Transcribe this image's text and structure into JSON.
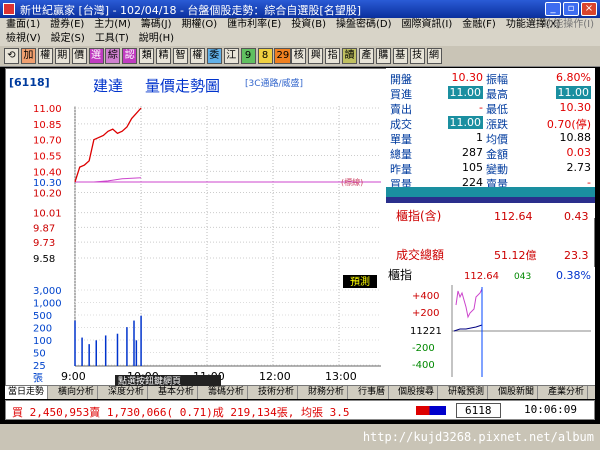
{
  "window": {
    "title": "新世紀贏家 [台灣] - 102/04/18 - 台盤個股走勢：綜合自選股[名望股]",
    "min": "_",
    "max": "▫",
    "close": "×"
  },
  "menu1": [
    "畫面(1)",
    "證券(E)",
    "主力(M)",
    "籌碼(J)",
    "期權(O)",
    "匯市利率(E)",
    "投資(B)",
    "操盤密碼(D)",
    "國際資訊(I)",
    "金融(F)",
    "功能選擇(X)"
  ],
  "menu1_right": "功能操作(I)",
  "menu2": [
    "檢視(V)",
    "設定(S)",
    "工具(T)",
    "說明(H)"
  ],
  "toolbar": [
    {
      "t": "⟲",
      "c": "#e8e4d8",
      "f": "#000"
    },
    {
      "t": "加",
      "c": "#f0a070",
      "f": "#000"
    },
    {
      "t": "權",
      "c": "#e8e4d8",
      "f": "#000"
    },
    {
      "t": "期",
      "c": "#e8e4d8",
      "f": "#000"
    },
    {
      "t": "價",
      "c": "#e8e4d8",
      "f": "#000"
    },
    {
      "t": "選",
      "c": "#c03cc0",
      "f": "#fff"
    },
    {
      "t": "綜",
      "c": "#d080d0",
      "f": "#000"
    },
    {
      "t": "認",
      "c": "#c03cc0",
      "f": "#fff"
    },
    {
      "t": "類",
      "c": "#e8e4d8",
      "f": "#000"
    },
    {
      "t": "精",
      "c": "#e8e4d8",
      "f": "#000"
    },
    {
      "t": "智",
      "c": "#e8e4d8",
      "f": "#000"
    },
    {
      "t": "權",
      "c": "#e8e4d8",
      "f": "#000"
    },
    {
      "t": "委",
      "c": "#60b0e8",
      "f": "#000"
    },
    {
      "t": "江",
      "c": "#e8e4d8",
      "f": "#000"
    },
    {
      "t": "9",
      "c": "#60c060",
      "f": "#000"
    },
    {
      "t": "8",
      "c": "#f0d040",
      "f": "#000"
    },
    {
      "t": "29",
      "c": "#f08020",
      "f": "#000"
    },
    {
      "t": "核",
      "c": "#e8e4d8",
      "f": "#000"
    },
    {
      "t": "興",
      "c": "#e8e4d8",
      "f": "#000"
    },
    {
      "t": "指",
      "c": "#e8e4d8",
      "f": "#000"
    },
    {
      "t": "讀",
      "c": "#c0c060",
      "f": "#000"
    },
    {
      "t": "產",
      "c": "#e8e4d8",
      "f": "#000"
    },
    {
      "t": "購",
      "c": "#e8e4d8",
      "f": "#000"
    },
    {
      "t": "基",
      "c": "#e8e4d8",
      "f": "#000"
    },
    {
      "t": "技",
      "c": "#e8e4d8",
      "f": "#000"
    },
    {
      "t": "網",
      "c": "#e8e4d8",
      "f": "#000"
    }
  ],
  "stock": {
    "code": "[6118]",
    "name": "建達",
    "chart_title": "量價走勢圖",
    "sub": "[3C通路/威盛]"
  },
  "price_axis": [
    "11.00",
    "10.85",
    "10.70",
    "10.55",
    "10.40",
    "10.30",
    "10.20",
    "10.01",
    "9.87",
    "9.73",
    "9.58"
  ],
  "price_axis_ref": "10.30",
  "ref_tag": "(標線)",
  "vol_axis": [
    "3,000",
    "1,000",
    "500",
    "200",
    "100",
    "50",
    "25",
    "張"
  ],
  "time_axis": [
    "9:00",
    "10:00",
    "11:00",
    "12:00",
    "13:00"
  ],
  "predict_button": "預測",
  "info": {
    "open": {
      "label": "開盤",
      "value": "10.30"
    },
    "amp": {
      "label": "振幅",
      "value": "6.80%"
    },
    "bid": {
      "label": "買進",
      "value": "11.00"
    },
    "high": {
      "label": "最高",
      "value": "11.00"
    },
    "ask": {
      "label": "賣出",
      "value": "-"
    },
    "low": {
      "label": "最低",
      "value": "10.30"
    },
    "last": {
      "label": "成交",
      "value": "11.00"
    },
    "chg": {
      "label": "漲跌",
      "value": "0.70(停)"
    },
    "unit": {
      "label": "單量",
      "value": "1"
    },
    "avg": {
      "label": "均價",
      "value": "10.88"
    },
    "vol": {
      "label": "總量",
      "value": "287"
    },
    "amt": {
      "label": "金額",
      "value": "0.03"
    },
    "yvol": {
      "label": "昨量",
      "value": "105"
    },
    "turn": {
      "label": "變動",
      "value": "2.73"
    },
    "buy": {
      "label": "買量",
      "value": "224"
    },
    "sell": {
      "label": "賣量",
      "value": "-"
    }
  },
  "index_box": {
    "label": "櫃指(含)",
    "value": "112.64",
    "chg": "0.43",
    "total_label": "成交總額",
    "total": "51.12億",
    "total_chg": "23.3"
  },
  "mini": {
    "label": "櫃指",
    "value": "112.64",
    "chg": "043",
    "pct": "0.38%",
    "axis": [
      "+400",
      "+200",
      "11221",
      "-200",
      "-400"
    ]
  },
  "tabs": [
    "當日走勢",
    "橫向分析",
    "深度分析",
    "基本分析",
    "籌碼分析",
    "技術分析",
    "財務分析",
    "行事曆",
    "個股搜尋",
    "研報預測",
    "個股新聞",
    "產業分析"
  ],
  "status": {
    "ticker": "買 2,450,953賣 1,730,066( 0.71)成 219,134張, 均張 3.5",
    "code": "6118",
    "time": "10:06:09"
  },
  "tooltip": "點選按鈕鍵網頁",
  "watermark": "http://kujd3268.pixnet.net/album",
  "chart_data": {
    "type": "line",
    "x_label": "",
    "y_label": "",
    "price_range": [
      9.58,
      11.0
    ],
    "price_series": [
      [
        0,
        10.3
      ],
      [
        2,
        10.44
      ],
      [
        4,
        10.46
      ],
      [
        6,
        10.5
      ],
      [
        8,
        10.7
      ],
      [
        10,
        10.72
      ],
      [
        12,
        10.74
      ],
      [
        14,
        10.78
      ],
      [
        16,
        10.8
      ],
      [
        18,
        10.76
      ],
      [
        20,
        10.78
      ],
      [
        22,
        10.82
      ],
      [
        24,
        10.9
      ],
      [
        26,
        10.95
      ],
      [
        28,
        11.0
      ]
    ],
    "avg_series": [
      [
        0,
        10.3
      ],
      [
        8,
        10.3
      ],
      [
        14,
        10.31
      ],
      [
        20,
        10.33
      ],
      [
        28,
        10.34
      ]
    ],
    "volume": [
      [
        0,
        120
      ],
      [
        3,
        20
      ],
      [
        6,
        10
      ],
      [
        9,
        15
      ],
      [
        13,
        25
      ],
      [
        18,
        30
      ],
      [
        22,
        60
      ],
      [
        25,
        120
      ],
      [
        26,
        15
      ],
      [
        28,
        200
      ]
    ]
  }
}
